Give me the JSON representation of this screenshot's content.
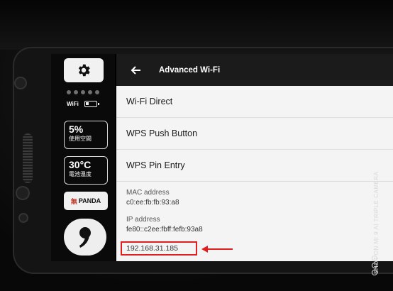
{
  "statusRail": {
    "wifiLabel": "WiFi",
    "storageTile": {
      "value": "5%",
      "label": "使用空間"
    },
    "tempTile": {
      "value": "30°C",
      "label": "電池溫度"
    },
    "brand": {
      "mark": "無",
      "name": "PANDA"
    },
    "batteryLevel": 0.3
  },
  "appBar": {
    "title": "Advanced Wi-Fi",
    "backIcon": "arrow-back-icon"
  },
  "menu": [
    {
      "id": "wifi-direct",
      "label": "Wi-Fi Direct"
    },
    {
      "id": "wps-push",
      "label": "WPS Push Button"
    },
    {
      "id": "wps-pin",
      "label": "WPS Pin Entry"
    }
  ],
  "macAddress": {
    "label": "MAC address",
    "value": "c0:ee:fb:fb:93:a8"
  },
  "ipAddress": {
    "label": "IP address",
    "ipv6": "fe80::c2ee:fbff:fefb:93a8",
    "ipv4": "192.168.31.185"
  },
  "annotation": {
    "color": "#e02020"
  },
  "watermark": {
    "text": "SHOT ON MI 9  AI TRIPLE CAMERA"
  },
  "colors": {
    "appBar": "#1b1b1b",
    "listBg": "#f4f4f4",
    "highlight": "#e02020"
  }
}
